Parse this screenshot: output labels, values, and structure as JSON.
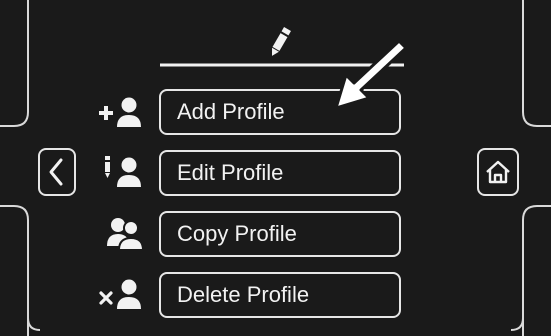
{
  "menu": {
    "items": [
      {
        "id": "add",
        "label": "Add Profile",
        "icon": "add-user-icon"
      },
      {
        "id": "edit",
        "label": "Edit Profile",
        "icon": "edit-user-icon"
      },
      {
        "id": "copy",
        "label": "Copy Profile",
        "icon": "copy-users-icon"
      },
      {
        "id": "delete",
        "label": "Delete Profile",
        "icon": "delete-user-icon"
      }
    ]
  },
  "nav": {
    "back_icon": "chevron-left-icon",
    "home_icon": "home-icon"
  },
  "header": {
    "icon": "pencil-icon"
  },
  "annotation": {
    "icon": "pointer-arrow-icon"
  },
  "colors": {
    "background": "#1a1a1a",
    "outline": "#e6e6e6",
    "text": "#f2f2f2"
  }
}
